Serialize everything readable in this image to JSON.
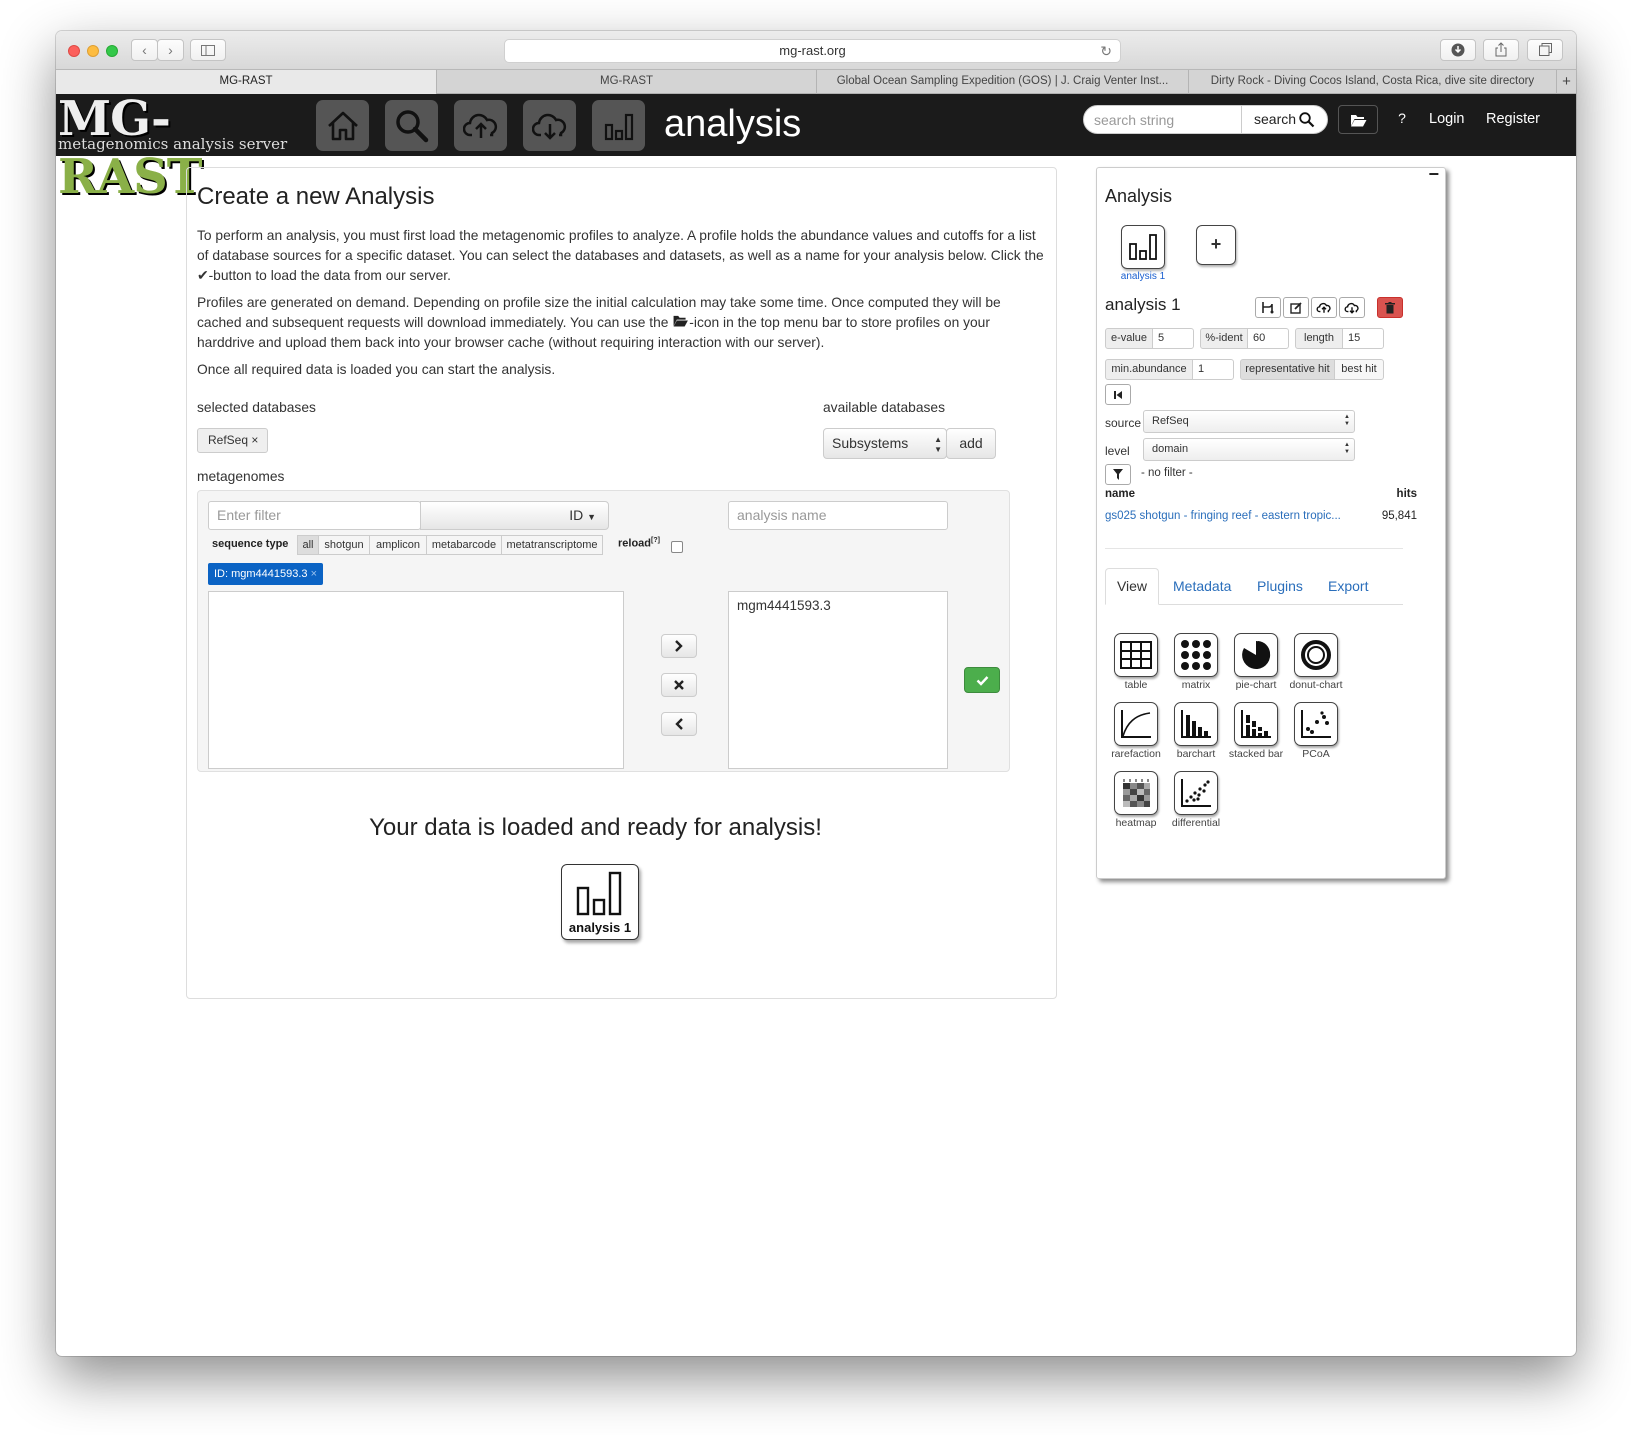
{
  "browser": {
    "url": "mg-rast.org",
    "tabs": [
      "MG-RAST",
      "MG-RAST",
      "Global Ocean Sampling Expedition (GOS) | J. Craig Venter Inst...",
      "Dirty Rock - Diving Cocos Island, Costa Rica, dive site directory"
    ]
  },
  "navbar": {
    "logo": {
      "part1": "MG-",
      "part2": "RAST",
      "subtitle": "metagenomics analysis server"
    },
    "icons": [
      "home-icon",
      "search-icon",
      "upload-icon",
      "download-icon",
      "analysis-icon"
    ],
    "title": "analysis",
    "search_placeholder": "search string",
    "search_button": "search",
    "help": "?",
    "login": "Login",
    "register": "Register"
  },
  "main": {
    "title": "Create a new Analysis",
    "para1_a": "To perform an analysis, you must first load the metagenomic profiles to analyze. A profile holds the abundance values and cutoffs for a list of database sources for a specific dataset. You can select the databases and datasets, as well as a name for your analysis below. Click the ",
    "para1_b": "-button to load the data from our server.",
    "para2_a": "Profiles are generated on demand. Depending on profile size the initial calculation may take some time. Once computed they will be cached and subsequent requests will download immediately. You can use the ",
    "para2_b": "-icon in the top menu bar to store profiles on your harddrive and upload them back into your browser cache (without requiring interaction with our server).",
    "para3": "Once all required data is loaded you can start the analysis.",
    "selected_databases_label": "selected databases",
    "selected_database": "RefSeq ×",
    "available_databases_label": "available databases",
    "available_database_selected": "Subsystems",
    "add_button": "add",
    "metagenomes_label": "metagenomes",
    "filter_placeholder": "Enter filter",
    "filter_type": "ID",
    "analysis_name_placeholder": "analysis name",
    "sequence_type_label": "sequence type",
    "sequence_types": [
      "all",
      "shotgun",
      "amplicon",
      "metabarcode",
      "metatranscriptome"
    ],
    "reload_label": "reload",
    "reload_sup": "[?]",
    "filter_tag": "ID: mgm4441593.3",
    "filter_tag_x": "×",
    "selected_metagenome": "mgm4441593.3",
    "ready_message": "Your data is loaded and ready for analysis!",
    "analysis_tile_label": "analysis 1"
  },
  "sidebar": {
    "title": "Analysis",
    "minimize": "−",
    "tile_label": "analysis 1",
    "add_tile": "+",
    "analysis_name": "analysis 1",
    "evalue_label": "e-value",
    "evalue": "5",
    "ident_label": "%-ident",
    "ident": "60",
    "length_label": "length",
    "length": "15",
    "minabundance_label": "min.abundance",
    "minabundance": "1",
    "rep_hit": "representative hit",
    "best_hit": "best hit",
    "source_label": "source",
    "source": "RefSeq",
    "level_label": "level",
    "level": "domain",
    "no_filter": "- no filter -",
    "col_name": "name",
    "col_hits": "hits",
    "row_name": "gs025 shotgun - fringing reef - eastern tropic...",
    "row_hits": "95,841",
    "tabs": [
      "View",
      "Metadata",
      "Plugins",
      "Export"
    ],
    "views": [
      "table",
      "matrix",
      "pie-chart",
      "donut-chart",
      "rarefaction",
      "barchart",
      "stacked bar",
      "PCoA",
      "heatmap",
      "differential"
    ],
    "colors": {
      "link": "#2a6ebb",
      "danger": "#d9534f",
      "success": "#4cae4c",
      "tag": "#0b63c4"
    }
  }
}
